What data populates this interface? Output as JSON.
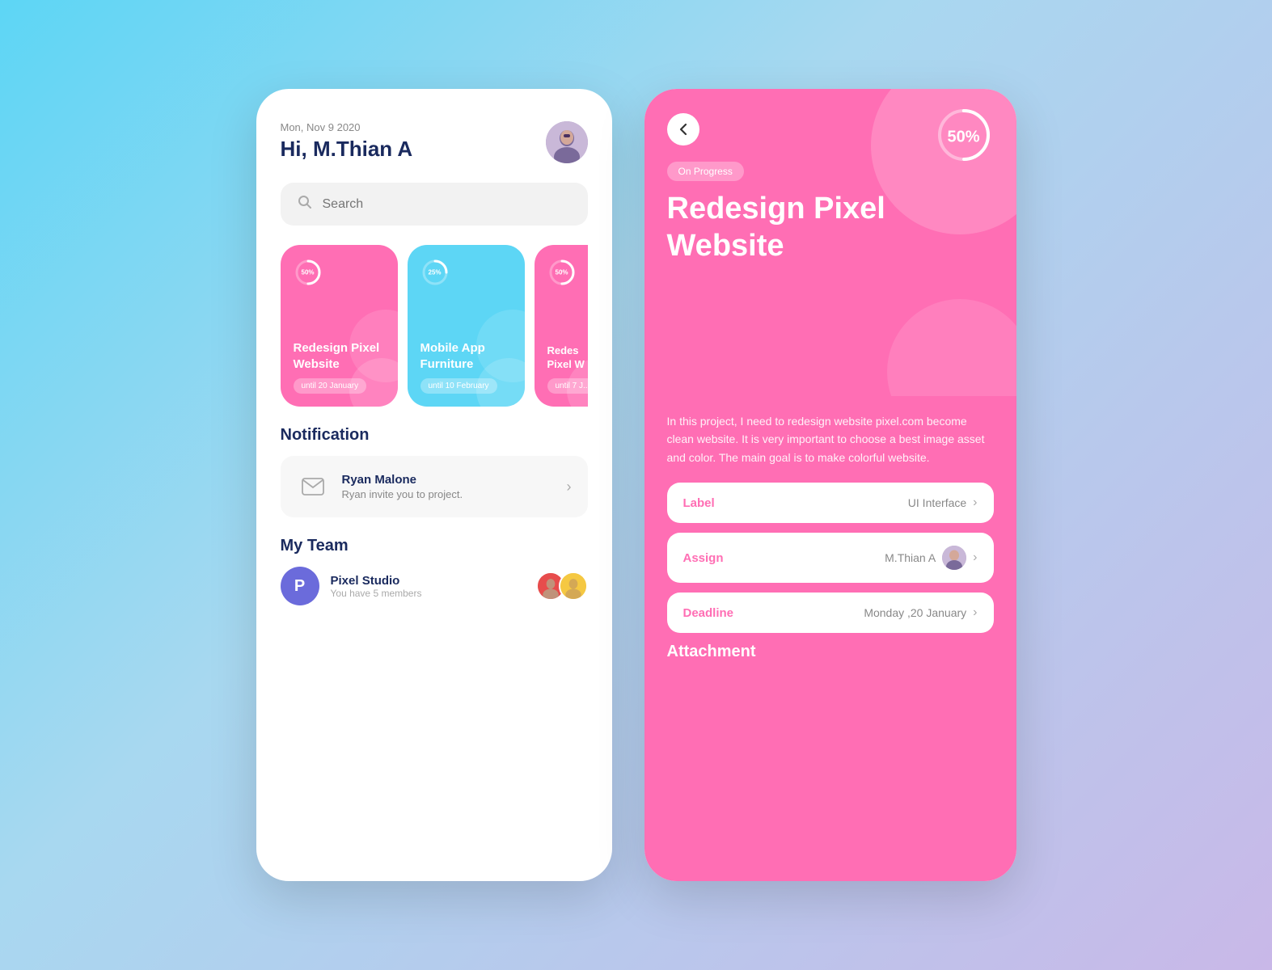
{
  "background": "linear-gradient(135deg, #5dd6f5 0%, #a8d8f0 40%, #c9b8e8 100%)",
  "left_phone": {
    "header": {
      "date": "Mon, Nov 9 2020",
      "greeting": "Hi, M.Thian A"
    },
    "search": {
      "placeholder": "Search"
    },
    "cards": [
      {
        "id": "card1",
        "color": "pink",
        "progress": 50,
        "title": "Redesign Pixel Website",
        "date": "until 20 January"
      },
      {
        "id": "card2",
        "color": "blue",
        "progress": 25,
        "title": "Mobile App Furniture",
        "date": "until 10 February"
      },
      {
        "id": "card3",
        "color": "pink2",
        "progress": 50,
        "title": "Redes Pixel W",
        "date": "until 7 J..."
      }
    ],
    "notification": {
      "section_title": "Notification",
      "sender_name": "Ryan Malone",
      "message": "Ryan invite you to project."
    },
    "team": {
      "section_title": "My Team",
      "name": "Pixel Studio",
      "members_text": "You have 5 members",
      "logo_letter": "P"
    }
  },
  "right_phone": {
    "back_label": "<",
    "status": "On Progress",
    "progress_pct": "50%",
    "title": "Redesign Pixel Website",
    "description": "In this project, I need to redesign website pixel.com become clean website. It is very important to choose a best image asset and color. The main goal is to make colorful website.",
    "details": [
      {
        "label": "Label",
        "value": "UI Interface"
      },
      {
        "label": "Assign",
        "value": "M.Thian A"
      },
      {
        "label": "Deadline",
        "value": "Monday ,20 January"
      }
    ],
    "attachment_title": "Attachment"
  }
}
